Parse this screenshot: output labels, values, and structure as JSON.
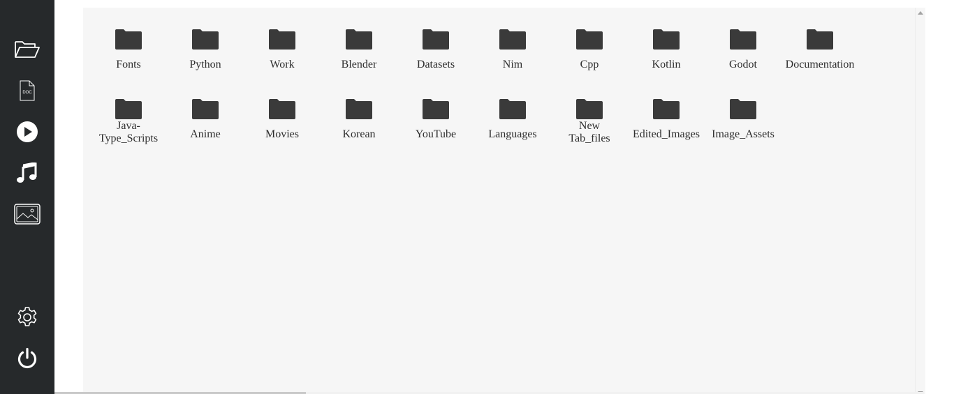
{
  "sidebar": {
    "items": [
      {
        "icon": "folder-open-icon",
        "label": "Files"
      },
      {
        "icon": "doc-file-icon",
        "label": "DOC"
      },
      {
        "icon": "play-icon",
        "label": "Videos"
      },
      {
        "icon": "music-note-icon",
        "label": "Music"
      },
      {
        "icon": "image-icon",
        "label": "Images"
      },
      {
        "icon": "gear-icon",
        "label": "Settings"
      },
      {
        "icon": "power-icon",
        "label": "Power"
      }
    ],
    "doc_icon_text": "DOC",
    "background": "#26292b",
    "icon_color": "#ffffff"
  },
  "folders": [
    {
      "name": "Fonts"
    },
    {
      "name": "Python"
    },
    {
      "name": "Work"
    },
    {
      "name": "Blender"
    },
    {
      "name": "Datasets"
    },
    {
      "name": "Nim"
    },
    {
      "name": "Cpp"
    },
    {
      "name": "Kotlin"
    },
    {
      "name": "Godot"
    },
    {
      "name": "Documentation"
    },
    {
      "name": "Java-Type_Scripts"
    },
    {
      "name": "Anime"
    },
    {
      "name": "Movies"
    },
    {
      "name": "Korean"
    },
    {
      "name": "YouTube"
    },
    {
      "name": "Languages"
    },
    {
      "name": "New Tab_files"
    },
    {
      "name": "Edited_Images"
    },
    {
      "name": "Image_Assets"
    }
  ],
  "colors": {
    "panel_background": "#f6f6f6",
    "folder_icon": "#3a3a3a",
    "label_text": "#2d2d2d"
  }
}
